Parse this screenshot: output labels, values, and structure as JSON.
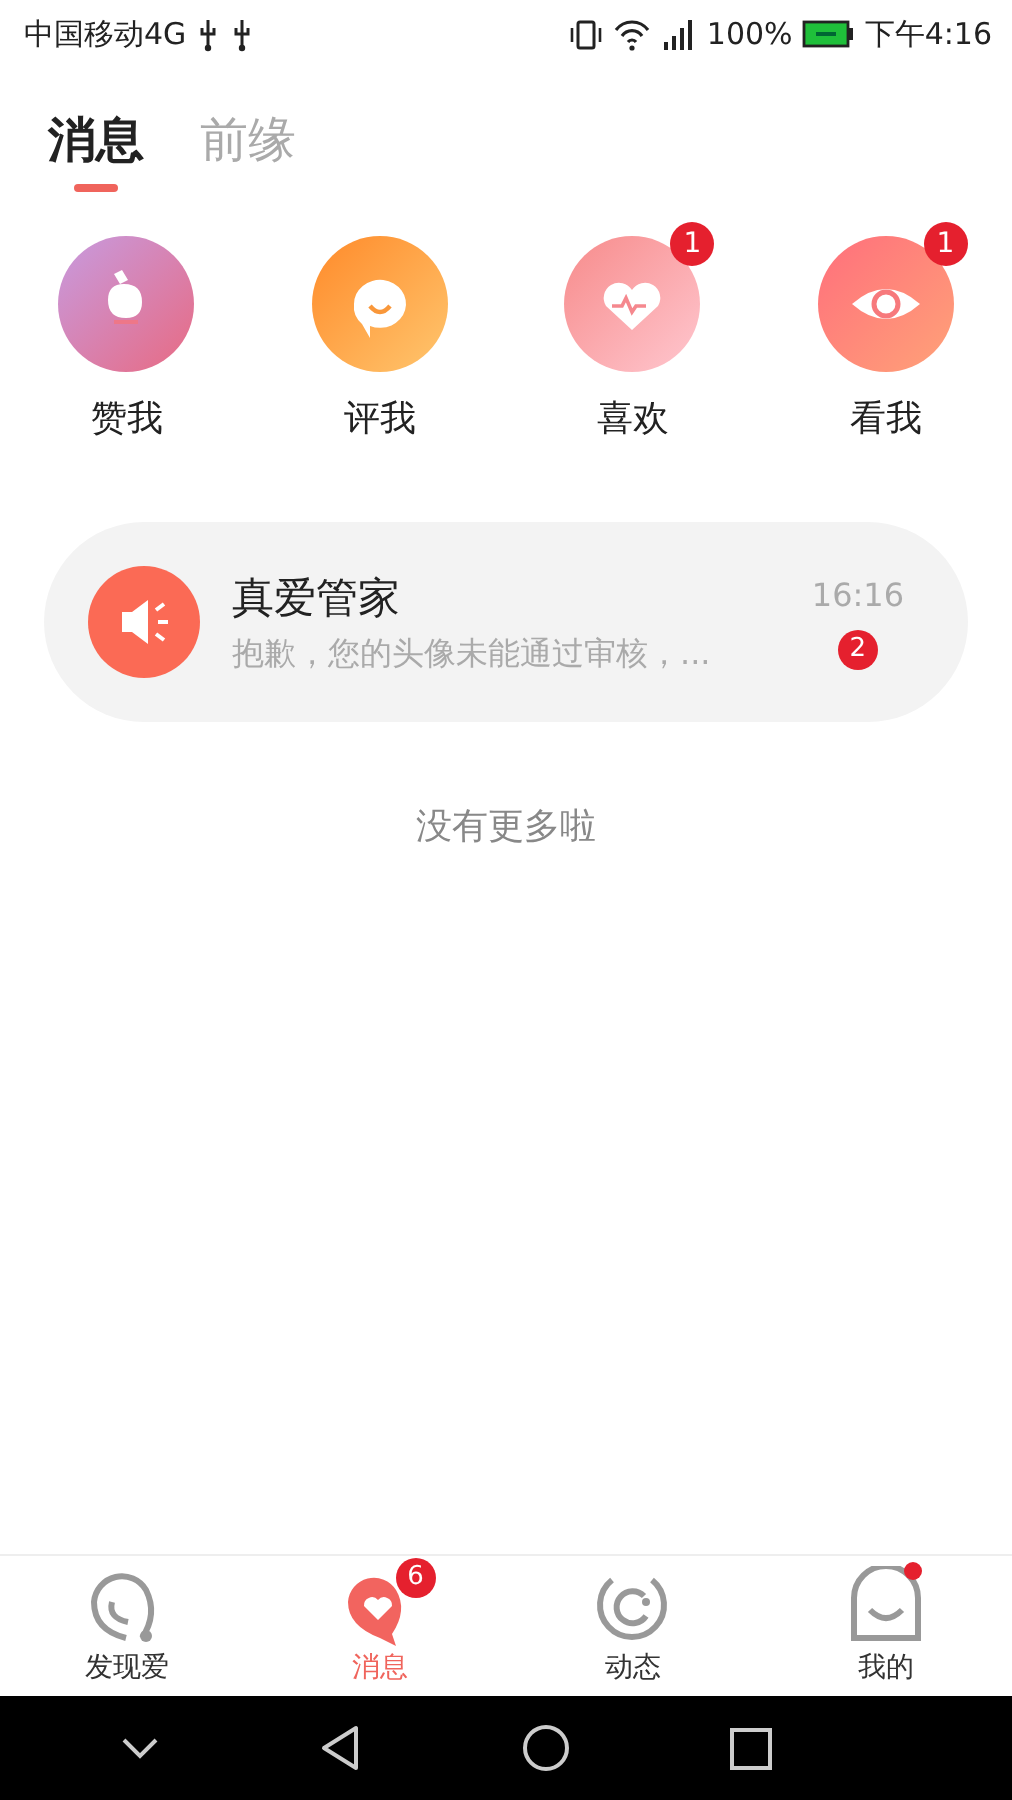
{
  "status_bar": {
    "carrier": "中国移动4G",
    "battery": "100%",
    "time": "下午4:16"
  },
  "tabs": [
    {
      "label": "消息",
      "selected": true
    },
    {
      "label": "前缘",
      "selected": false
    }
  ],
  "categories": [
    {
      "kind": "like",
      "label": "赞我"
    },
    {
      "kind": "comment",
      "label": "评我"
    },
    {
      "kind": "heart",
      "label": "喜欢",
      "badge": "1"
    },
    {
      "kind": "eye",
      "label": "看我",
      "badge": "1"
    }
  ],
  "messages": [
    {
      "title": "真爱管家",
      "preview": "抱歉，您的头像未能通过审核，...",
      "time": "16:16",
      "badge": "2"
    }
  ],
  "footer": "没有更多啦",
  "nav": [
    {
      "kind": "discover",
      "label": "发现爱",
      "selected": false,
      "dot": false
    },
    {
      "kind": "message",
      "label": "消息",
      "selected": true,
      "badge": "6",
      "dot": false
    },
    {
      "kind": "moments",
      "label": "动态",
      "selected": false,
      "dot": false
    },
    {
      "kind": "me",
      "label": "我的",
      "selected": false,
      "dot": true
    }
  ]
}
